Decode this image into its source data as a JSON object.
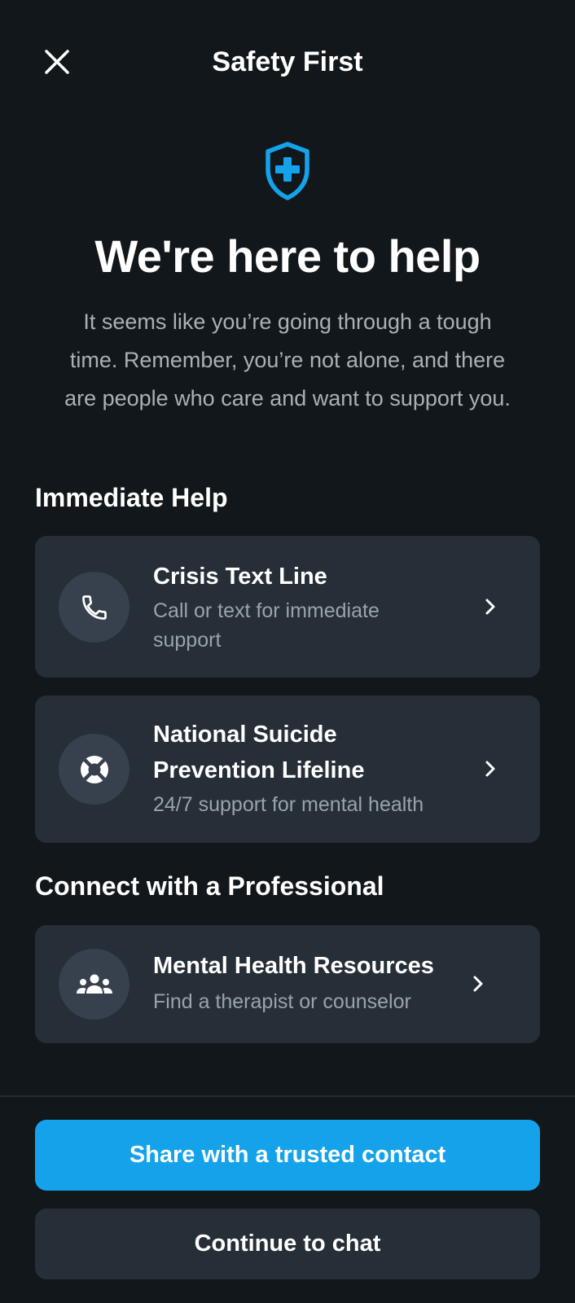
{
  "header": {
    "title": "Safety First"
  },
  "hero": {
    "icon": "shield-plus-icon",
    "title": "We're here to help",
    "message_line1": "It seems like you’re going through a tough",
    "message_line2": "time. Remember, you’re not alone, and there",
    "message_line3": "are people who care and want to support you."
  },
  "sections": {
    "immediate_help": "Immediate Help",
    "professional": "Connect with a Professional"
  },
  "cards": {
    "crisis": {
      "icon": "phone-icon",
      "title": "Crisis Text Line",
      "subtitle_line1": "Call or text for immediate",
      "subtitle_line2": "support"
    },
    "lifeline": {
      "icon": "lifebuoy-icon",
      "title_line1": "National Suicide",
      "title_line2": "Prevention Lifeline",
      "subtitle": "24/7 support for mental health"
    },
    "mental": {
      "icon": "group-icon",
      "title": "Mental Health Resources",
      "subtitle": "Find a therapist or counselor"
    }
  },
  "buttons": {
    "share": "Share with a trusted contact",
    "continue": "Continue to chat"
  },
  "colors": {
    "background": "#12171b",
    "card": "#262f37",
    "accent": "#14a3ea",
    "muted_text": "#9aa3ab"
  }
}
